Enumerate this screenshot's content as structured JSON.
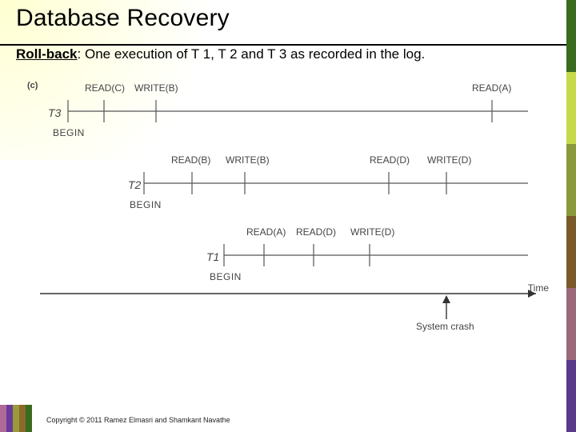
{
  "title": "Database Recovery",
  "subtitle_label": "Roll-back",
  "subtitle_rest": ":  One execution of T 1, T 2 and T 3 as recorded in the log.",
  "diagram": {
    "part": "(c)",
    "begin": "BEGIN",
    "time": "Time",
    "crash": "System crash",
    "t3": {
      "name": "T3",
      "ops": [
        "READ(C)",
        "WRITE(B)",
        "READ(A)"
      ]
    },
    "t2": {
      "name": "T2",
      "ops": [
        "READ(B)",
        "WRITE(B)",
        "READ(D)",
        "WRITE(D)"
      ]
    },
    "t1": {
      "name": "T1",
      "ops": [
        "READ(A)",
        "READ(D)",
        "WRITE(D)"
      ]
    }
  },
  "footer": "Copyright © 2011 Ramez Elmasri and Shamkant Navathe"
}
